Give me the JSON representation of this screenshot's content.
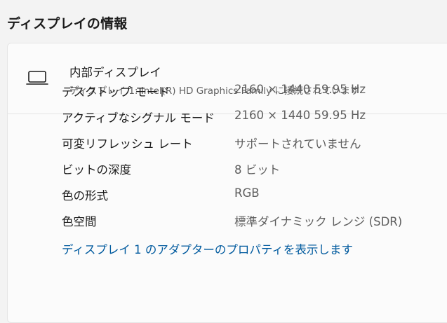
{
  "page": {
    "title": "ディスプレイの情報"
  },
  "display": {
    "icon": "laptop-icon",
    "name": "内部ディスプレイ",
    "description": "ディスプレイ 1: Intel(R) HD Graphics Family に接続されています"
  },
  "properties": [
    {
      "label": "デスクトップ モード",
      "value": "2160 × 1440 59.95 Hz"
    },
    {
      "label": "アクティブなシグナル モード",
      "value": "2160 × 1440 59.95 Hz"
    },
    {
      "label": "可変リフレッシュ レート",
      "value": "サポートされていません"
    },
    {
      "label": "ビットの深度",
      "value": "8 ビット"
    },
    {
      "label": "色の形式",
      "value": "RGB"
    },
    {
      "label": "色空間",
      "value": "標準ダイナミック レンジ (SDR)"
    }
  ],
  "links": {
    "adapter_properties": "ディスプレイ 1 のアダプターのプロパティを表示します"
  },
  "colors": {
    "link": "#005a9e",
    "background": "#f3f3f3",
    "card": "#fbfbfb"
  }
}
